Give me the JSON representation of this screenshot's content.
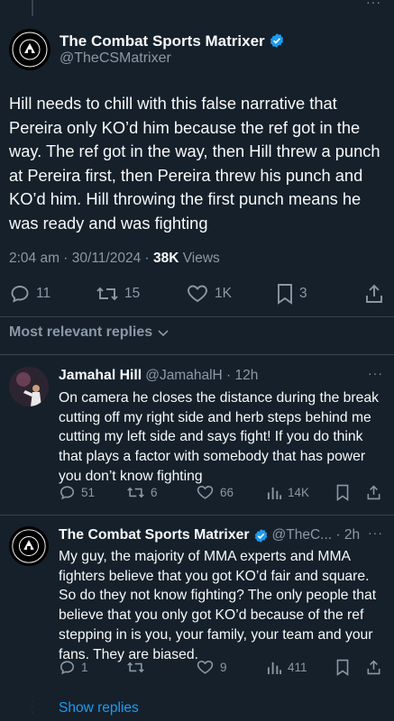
{
  "main_tweet": {
    "author_name": "The Combat Sports Matrixer",
    "handle": "@TheCSMatrixer",
    "avatar_text_top": "THE COMBAT",
    "avatar_text_bottom": "SPORTS MATRIXER",
    "text": "Hill needs to chill with this false narrative that Pereira only KO’d him because the ref got in the way. The ref got in the way, then Hill threw a punch at Pereira first, then Pereira threw his punch and KO’d him. Hill throwing the first punch means he was ready and was fighting",
    "time": "2:04 am · 30/11/2024 · ",
    "views_count": "38K",
    "views_label": " Views",
    "replies": "11",
    "reposts": "15",
    "likes": "1K",
    "bookmarks": "3"
  },
  "relevant_label": "Most relevant replies",
  "replies": [
    {
      "author_name": "Jamahal Hill",
      "handle": "@JamahalH · 12h",
      "text": "On camera he closes the distance during the break cutting off my right side and herb steps behind me cutting my left side and says fight! If you do think that plays a factor with somebody that has power you don’t know fighting",
      "replies": "51",
      "reposts": "6",
      "likes": "66",
      "views": "14K"
    },
    {
      "author_name": "The Combat Sports Matrixer",
      "handle": "@TheC... · 2h",
      "text": "My guy, the majority of MMA experts and MMA fighters believe that you got KO’d fair and square. So do they not know fighting? The only people that believe that you only got KO’d because of the ref stepping in is you, your family, your team and your fans. They are biased.",
      "replies": "1",
      "reposts": "",
      "likes": "9",
      "views": "411"
    }
  ],
  "show_replies_label": "Show replies",
  "colors": {
    "background": "#15202b",
    "accent": "#1d9bf0",
    "muted": "#8b98a5",
    "divider": "#38444d"
  }
}
